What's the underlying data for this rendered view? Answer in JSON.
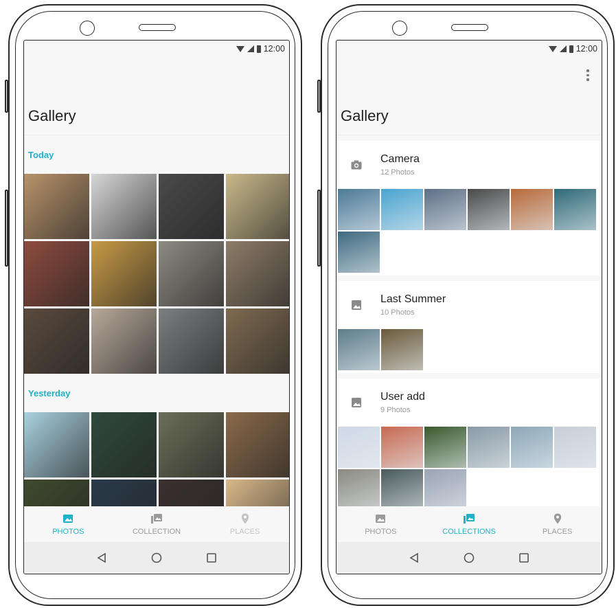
{
  "status": {
    "time": "12:00"
  },
  "left": {
    "title": "Gallery",
    "sections": [
      {
        "label": "Today",
        "photos": [
          "#b8926a",
          "#d6d6d6",
          "#4a4a4a",
          "#c9b98a",
          "#8e4b3f",
          "#c79a45",
          "#8d8a80",
          "#8d7c68",
          "#5a4a3e",
          "#b7a89a",
          "#7a7f80",
          "#7e6a50"
        ]
      },
      {
        "label": "Yesterday",
        "photos": [
          "#a9d2e0",
          "#2f4a3c",
          "#6b6e58",
          "#8a6a4a",
          "#3f4a2e",
          "#2a3a4a",
          "#3a3030",
          "#d9b88a"
        ]
      }
    ],
    "nav": [
      {
        "label": "PHOTOS",
        "state": "active",
        "icon": "photo-icon"
      },
      {
        "label": "COLLECTION",
        "state": "normal",
        "icon": "collection-icon"
      },
      {
        "label": "PLACES",
        "state": "faded",
        "icon": "place-icon"
      }
    ]
  },
  "right": {
    "title": "Gallery",
    "collections": [
      {
        "name": "Camera",
        "count": "12 Photos",
        "icon": "camera-icon",
        "photos": [
          "#4c7a98",
          "#4aa4d0",
          "#5e6f86",
          "#4a4a4a",
          "#b76a3a",
          "#2f6a78",
          "#3f6a80"
        ]
      },
      {
        "name": "Last Summer",
        "count": "10 Photos",
        "icon": "image-icon",
        "photos": [
          "#5d7d8a",
          "#6a5a3a"
        ]
      },
      {
        "name": "User add",
        "count": "9 Photos",
        "icon": "image-icon",
        "photos": [
          "#cfd9e6",
          "#c86a52",
          "#3a5a2e",
          "#8a9aa6",
          "#8da8b8",
          "#c8cfd8",
          "#8a8a80",
          "#4a5a5a",
          "#9aa4b4"
        ]
      }
    ],
    "nav": [
      {
        "label": "PHOTOS",
        "state": "normal",
        "icon": "photo-icon"
      },
      {
        "label": "COLLECTIONS",
        "state": "active",
        "icon": "collection-icon"
      },
      {
        "label": "PLACES",
        "state": "normal",
        "icon": "place-icon"
      }
    ]
  },
  "colors": {
    "accent": "#1fb1c8"
  }
}
